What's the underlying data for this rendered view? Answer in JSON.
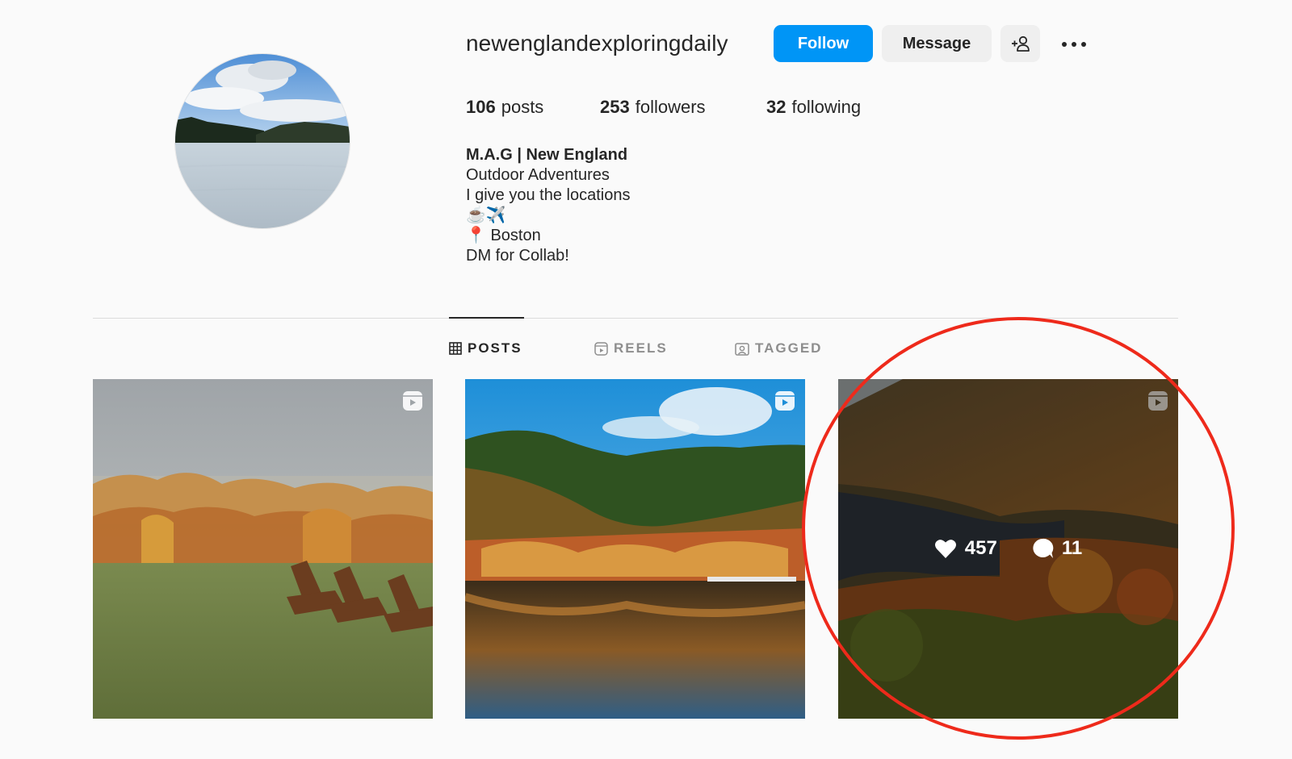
{
  "profile": {
    "username": "newenglandexploringdaily",
    "follow_label": "Follow",
    "message_label": "Message",
    "stats": {
      "posts_count": "106",
      "posts_label": "posts",
      "followers_count": "253",
      "followers_label": "followers",
      "following_count": "32",
      "following_label": "following"
    },
    "bio": {
      "name": "M.A.G | New England",
      "line1": "Outdoor Adventures",
      "line2": "I give you the locations",
      "emojis": "☕️✈️",
      "location_pin": "📍",
      "location": "Boston",
      "line4": "DM for Collab!"
    }
  },
  "tabs": {
    "posts": "POSTS",
    "reels": "REELS",
    "tagged": "TAGGED"
  },
  "posts": [
    {
      "is_reel": true
    },
    {
      "is_reel": true
    },
    {
      "is_reel": true,
      "hovered": true,
      "likes": "457",
      "comments": "11"
    }
  ],
  "colors": {
    "follow_button": "#0095f6",
    "annotation_circle": "#ee2a1b",
    "background": "#fafafa"
  },
  "icons": [
    "add-user-icon",
    "more-options-icon",
    "grid-icon",
    "reels-icon",
    "tagged-icon",
    "reel-badge-icon",
    "heart-icon",
    "comment-icon"
  ]
}
